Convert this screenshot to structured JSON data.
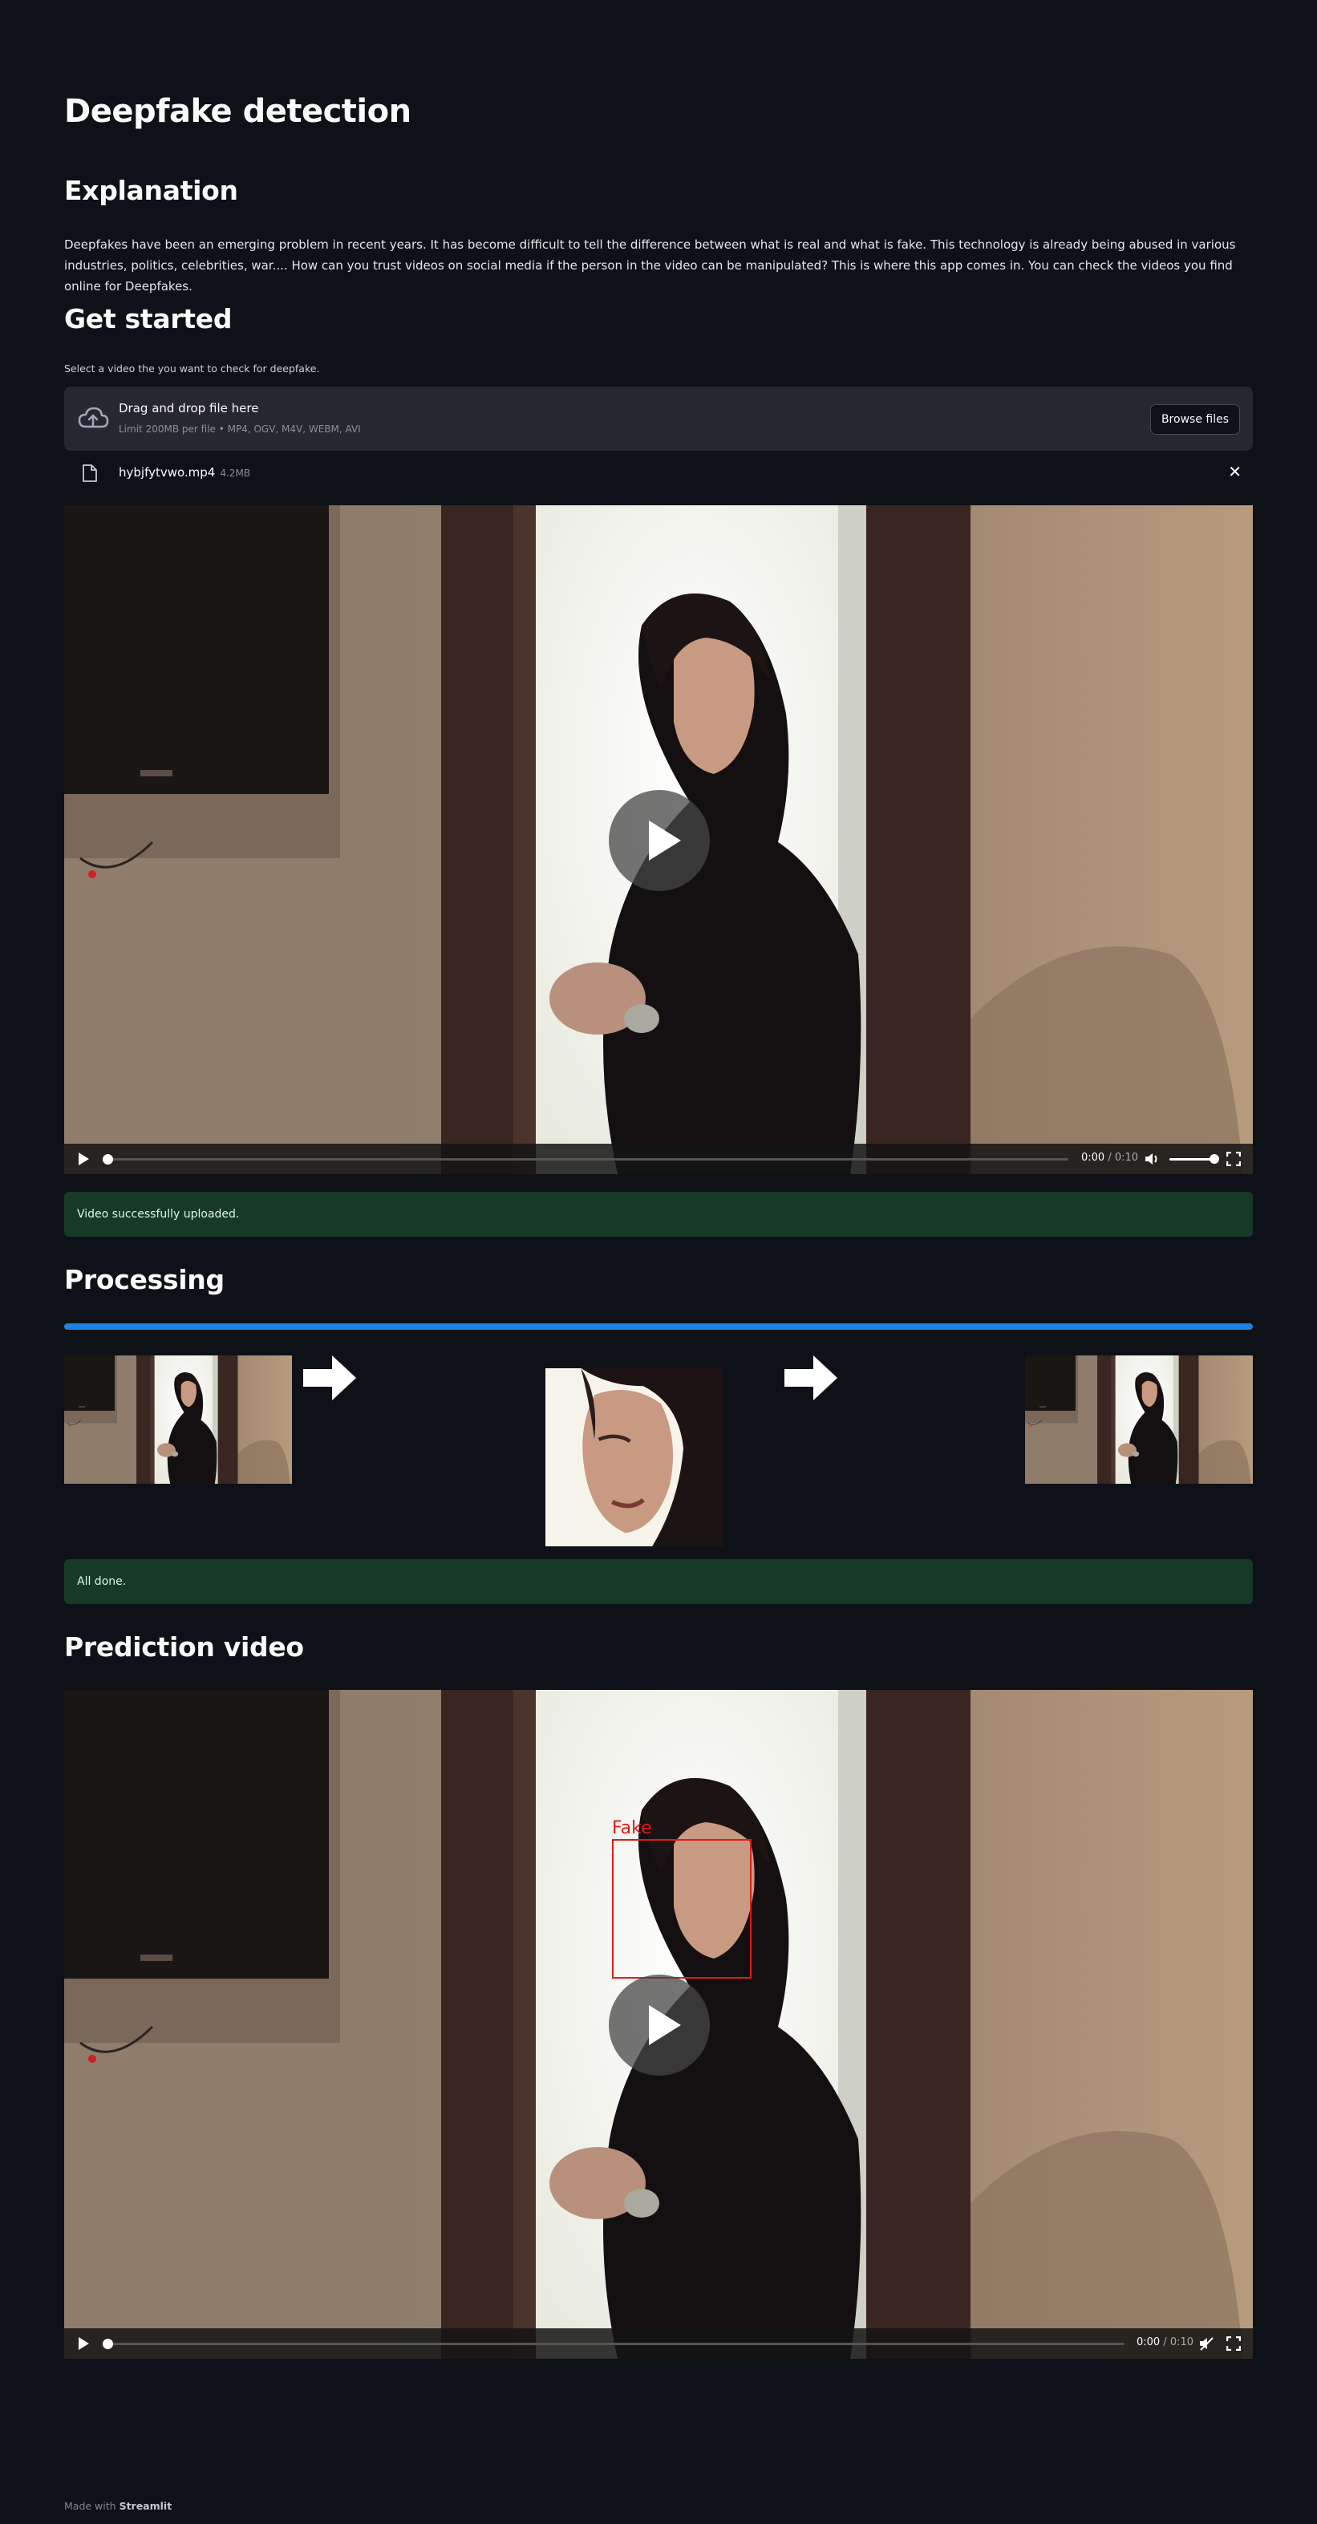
{
  "page": {
    "title": "Deepfake detection",
    "explanation_heading": "Explanation",
    "explanation_text": "Deepfakes have been an emerging problem in recent years. It has become difficult to tell the difference between what is real and what is fake. This technology is already being abused in various industries, politics, celebrities, war.... How can you trust videos on social media if the person in the video can be manipulated? This is where this app comes in. You can check the videos you find online for Deepfakes.",
    "get_started_heading": "Get started",
    "uploader_label": "Select a video the you want to check for deepfake."
  },
  "uploader": {
    "icon": "cloud-upload-icon",
    "title": "Drag and drop file here",
    "subtitle": "Limit 200MB per file • MP4, OGV, M4V, WEBM, AVI",
    "browse_label": "Browse files"
  },
  "uploaded_file": {
    "icon": "file-icon",
    "name": "hybjfytvwo.mp4",
    "size": "4.2MB",
    "remove_icon": "close-icon",
    "remove_label": "✕"
  },
  "input_video": {
    "time_current": "0:00",
    "time_total": "/ 0:10",
    "progress": 0,
    "volume": 1.0
  },
  "upload_status": "Video successfully uploaded.",
  "processing": {
    "heading": "Processing",
    "progress": 1.0,
    "status": "All done."
  },
  "prediction": {
    "heading": "Prediction video",
    "label": "Fake",
    "label_color": "#e21a1a",
    "time_current": "0:00",
    "time_total": "/ 0:10",
    "progress": 0
  },
  "footer": {
    "prefix": "Made with",
    "brand": "Streamlit"
  },
  "colors": {
    "background": "#0e1117",
    "accent": "#1c83e1",
    "success_bg": "#173928"
  }
}
